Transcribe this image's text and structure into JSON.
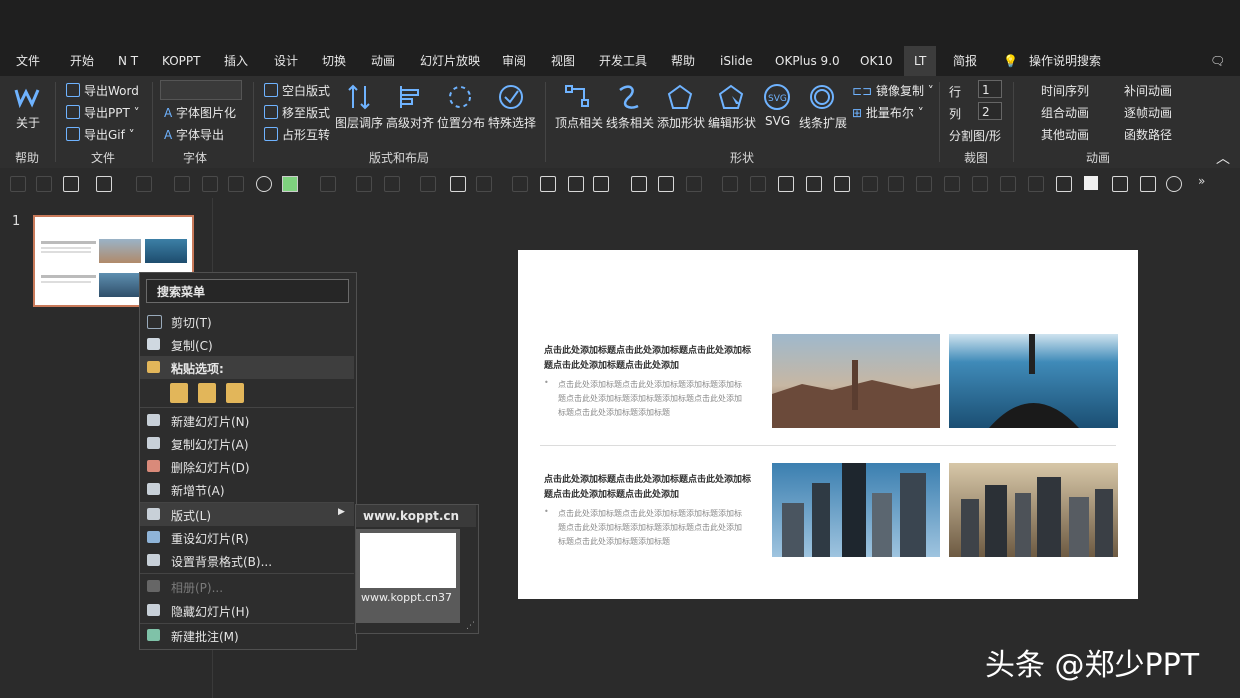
{
  "tabs": [
    "文件",
    "开始",
    "N T",
    "KOPPT",
    "插入",
    "设计",
    "切换",
    "动画",
    "幻灯片放映",
    "审阅",
    "视图",
    "开发工具",
    "帮助",
    "iSlide",
    "OKPlus 9.0",
    "OK10",
    "LT",
    "简报"
  ],
  "search": {
    "label": "操作说明搜索"
  },
  "ribbon": {
    "help": {
      "btn": "关于",
      "group": "帮助"
    },
    "file": {
      "items": [
        "导出Word",
        "导出PPT",
        "导出Gif"
      ],
      "group": "文件"
    },
    "font": {
      "items": [
        "字体图片化",
        "字体导出"
      ],
      "group": "字体"
    },
    "layout": {
      "small": [
        "空白版式",
        "移至版式",
        "占形互转"
      ],
      "big": [
        "图层调序",
        "高级对齐",
        "位置分布",
        "特殊选择"
      ],
      "group": "版式和布局"
    },
    "shape": {
      "big": [
        "顶点相关",
        "线条相关",
        "添加形状",
        "编辑形状",
        "SVG",
        "线条扩展"
      ],
      "small": [
        "镜像复制",
        "批量布尔"
      ],
      "group": "形状"
    },
    "crop": {
      "row_label": "行",
      "row_value": "1",
      "col_label": "列",
      "col_value": "2",
      "split": "分割图/形",
      "group": "裁图"
    },
    "anim": {
      "items": [
        "时间序列",
        "补间动画",
        "组合动画",
        "逐帧动画",
        "其他动画",
        "函数路径"
      ],
      "group": "动画"
    }
  },
  "thumbnail": {
    "number": "1"
  },
  "slide": {
    "top": {
      "title": "点击此处添加标题点击此处添加标题点击此处添加标题点击此处添加标题点击此处添加",
      "body": "点击此处添加标题点击此处添加标题添加标题添加标题点击此处添加标题添加标题添加标题点击此处添加标题点击此处添加标题添加标题"
    },
    "bottom": {
      "title": "点击此处添加标题点击此处添加标题点击此处添加标题点击此处添加标题点击此处添加",
      "body": "点击此处添加标题点击此处添加标题添加标题添加标题点击此处添加标题添加标题添加标题点击此处添加标题点击此处添加标题添加标题"
    }
  },
  "context_menu": {
    "search": "搜索菜单",
    "cut": "剪切(T)",
    "copy": "复制(C)",
    "paste_options": "粘贴选项:",
    "new_slide": "新建幻灯片(N)",
    "dup_slide": "复制幻灯片(A)",
    "del_slide": "删除幻灯片(D)",
    "new_section": "新增节(A)",
    "layout": "版式(L)",
    "reset": "重设幻灯片(R)",
    "bg": "设置背景格式(B)...",
    "album": "相册(P)...",
    "hide": "隐藏幻灯片(H)",
    "comment": "新建批注(M)"
  },
  "submenu": {
    "header": "www.koppt.cn",
    "thumb_label": "www.koppt.cn37"
  },
  "watermark": "头条 @郑少PPT",
  "colors": {
    "accent": "#6fb3ff",
    "ribbon_bg": "#2f2f2f",
    "menu_bg": "#2d2d2d",
    "thumb_border": "#c97a5a"
  }
}
